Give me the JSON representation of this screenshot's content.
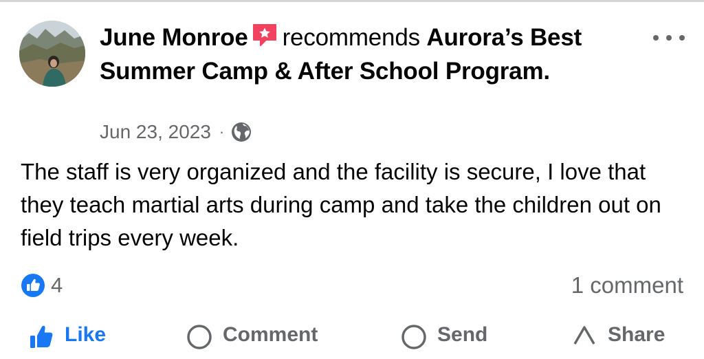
{
  "post": {
    "author": "June Monroe",
    "verb": "recommends",
    "page_name": "Aurora’s Best Summer Camp & After School Program.",
    "date": "Jun 23, 2023",
    "separator": "·",
    "privacy_icon": "globe-icon",
    "body": "The staff is very organized and the facility is secure, I love that they teach martial arts during camp and take the children out on field trips every week.",
    "like_count": "4",
    "comment_count": "1 comment"
  },
  "actions": [
    {
      "label": "Like",
      "icon": "thumbs-up-icon"
    },
    {
      "label": "Comment",
      "icon": "comment-icon"
    },
    {
      "label": "Send",
      "icon": "send-icon"
    },
    {
      "label": "Share",
      "icon": "share-icon"
    }
  ],
  "colors": {
    "badge_pink": "#f3425f",
    "like_blue": "#1877f2",
    "secondary_text": "#65676b",
    "primary_text": "#050505"
  }
}
